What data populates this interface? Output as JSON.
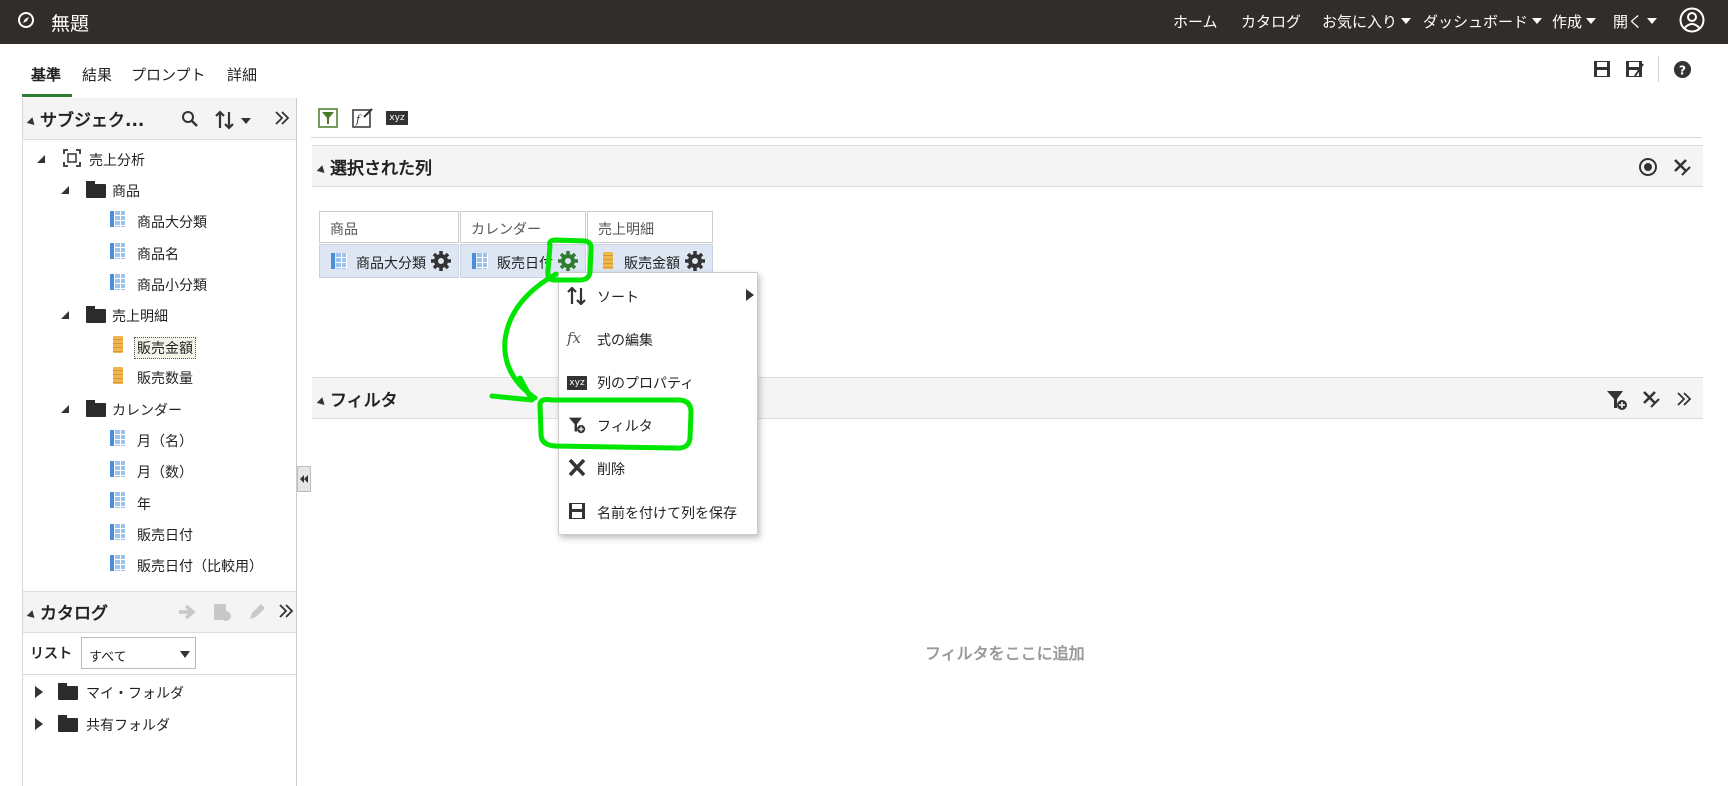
{
  "app": {
    "title": "無題"
  },
  "topnav": {
    "home": "ホーム",
    "catalog": "カタログ",
    "favorites": "お気に入り",
    "dashboard": "ダッシュボード",
    "create": "作成",
    "open": "開く"
  },
  "tabs": [
    "基準",
    "結果",
    "プロンプト",
    "詳細"
  ],
  "subject_panel": {
    "title": "サブジェク...",
    "root": "売上分析",
    "folders": [
      {
        "name": "商品",
        "columns": [
          "商品大分類",
          "商品名",
          "商品小分類"
        ]
      },
      {
        "name": "売上明細",
        "columns": [
          "販売金額",
          "販売数量"
        ]
      },
      {
        "name": "カレンダー",
        "columns": [
          "月（名）",
          "月（数）",
          "年",
          "販売日付",
          "販売日付（比較用）"
        ]
      }
    ]
  },
  "catalog_panel": {
    "title": "カタログ",
    "list_label": "リスト",
    "list_value": "すべて",
    "folders": [
      "マイ・フォルダ",
      "共有フォルダ"
    ]
  },
  "selected_columns": {
    "title": "選択された列",
    "columns": [
      {
        "group": "商品",
        "name": "商品大分類"
      },
      {
        "group": "カレンダー",
        "name": "販売日付"
      },
      {
        "group": "売上明細",
        "name": "販売金額"
      }
    ]
  },
  "filters": {
    "title": "フィルタ",
    "placeholder": "フィルタをここに追加"
  },
  "context_menu": {
    "items": [
      "ソート",
      "式の編集",
      "列のプロパティ",
      "フィルタ",
      "削除",
      "名前を付けて列を保存"
    ]
  },
  "toolbar": {
    "xyz_label": "xyz"
  },
  "colors": {
    "topbar": "#312d2a",
    "accent_green": "#00e600",
    "tab_underline": "#2e7d32"
  }
}
